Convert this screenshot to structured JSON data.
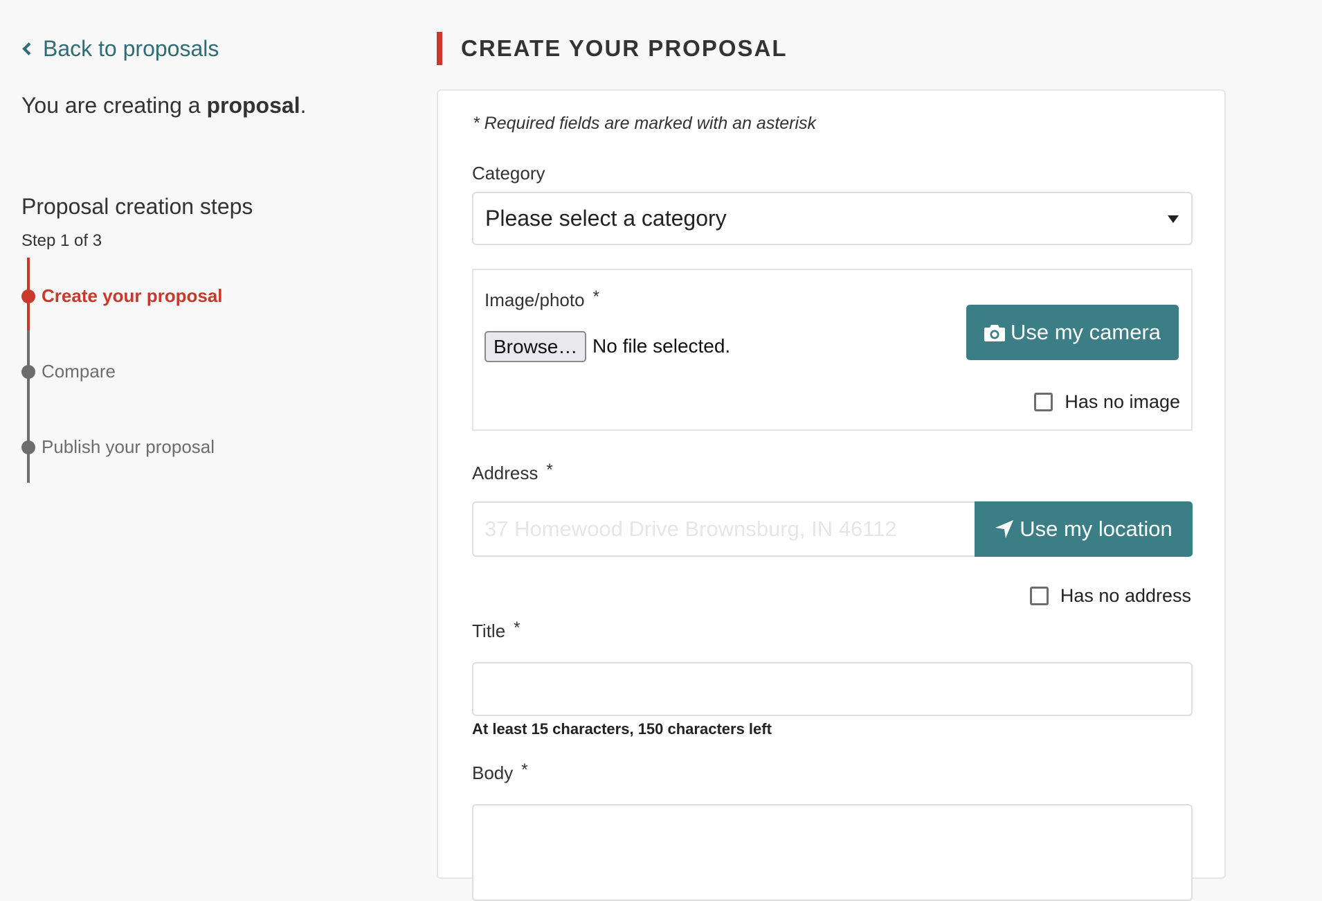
{
  "sidebar": {
    "back_link": "Back to proposals",
    "creating_prefix": "You are creating a ",
    "creating_bold": "proposal",
    "creating_suffix": ".",
    "steps_heading": "Proposal creation steps",
    "step_count": "Step 1 of 3",
    "steps": [
      {
        "label": "Create your proposal",
        "active": true
      },
      {
        "label": "Compare",
        "active": false
      },
      {
        "label": "Publish your proposal",
        "active": false
      }
    ]
  },
  "header": {
    "title": "CREATE YOUR PROPOSAL"
  },
  "form": {
    "required_note": "* Required fields are marked with an asterisk",
    "asterisk": "*",
    "category": {
      "label": "Category",
      "selected": "Please select a category"
    },
    "image": {
      "label": "Image/photo",
      "browse_label": "Browse…",
      "file_status": "No file selected.",
      "camera_button": "Use my camera",
      "no_image_label": "Has no image"
    },
    "address": {
      "label": "Address",
      "placeholder": "37 Homewood Drive Brownsburg, IN 46112",
      "value": "",
      "location_button": "Use my location",
      "no_address_label": "Has no address"
    },
    "title": {
      "label": "Title",
      "value": "",
      "help": "At least 15 characters, 150 characters left"
    },
    "body": {
      "label": "Body",
      "value": ""
    }
  },
  "colors": {
    "accent_red": "#c9392b",
    "teal": "#3b7e85",
    "link": "#2e6d74"
  }
}
